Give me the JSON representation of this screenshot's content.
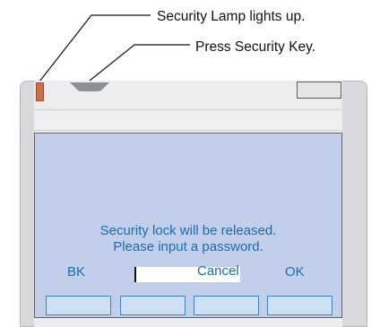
{
  "callouts": {
    "lamp": "Security Lamp lights up.",
    "key": "Press Security Key."
  },
  "screen": {
    "message_line_1": "Security lock will be released.",
    "message_line_2": "Please input a password.",
    "password_value": "",
    "softkeys": {
      "left": "BK",
      "middle": "Cancel",
      "right": "OK"
    }
  },
  "colors": {
    "screen_background": "#c2cfea",
    "screen_text": "#1c6bb0",
    "lamp": "#c8704b",
    "softkey_fill": "#cfe0f5",
    "softkey_border": "#3f83c7"
  },
  "icons": {
    "lamp": "security-lamp-icon",
    "key": "security-key-icon"
  }
}
